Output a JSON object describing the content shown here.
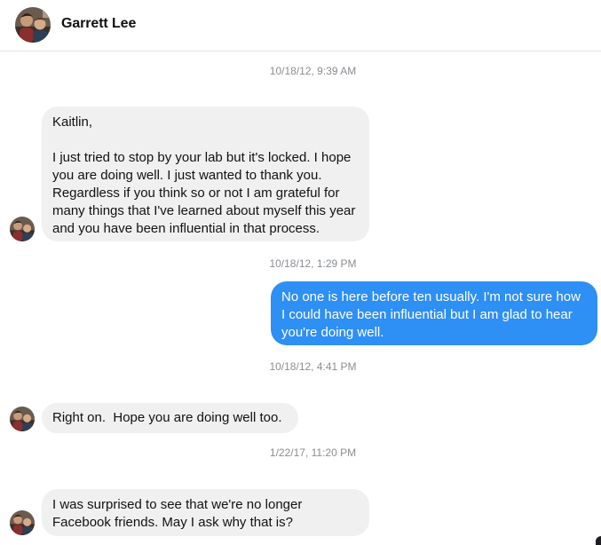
{
  "header": {
    "name": "Garrett Lee",
    "avatar_icon": "profile-photo"
  },
  "messages": [
    {
      "type": "timestamp",
      "text": "10/18/12, 9:39 AM"
    },
    {
      "type": "incoming",
      "greeting": "Kaitlin,",
      "text": "I just tried to stop by your lab but it's locked. I hope you are doing well. I just wanted to thank you. Regardless if you think so or not I am grateful for many things that I've learned about myself this year and you have been influential in that process."
    },
    {
      "type": "timestamp",
      "text": "10/18/12, 1:29 PM"
    },
    {
      "type": "outgoing",
      "text": "No one is here before ten usually. I'm not sure how I could have been influential but I am glad to hear you're doing well."
    },
    {
      "type": "timestamp",
      "text": "10/18/12, 4:41 PM"
    },
    {
      "type": "incoming",
      "text": "Right on.  Hope you are doing well too."
    },
    {
      "type": "timestamp",
      "text": "1/22/17, 11:20 PM"
    },
    {
      "type": "incoming",
      "text": "I was surprised to see that we're no longer Facebook friends. May I ask why that is?"
    }
  ],
  "colors": {
    "outgoing_bubble": "#2e8ff5",
    "incoming_bubble": "#f0f0f0",
    "timestamp_text": "#8a8d91"
  }
}
